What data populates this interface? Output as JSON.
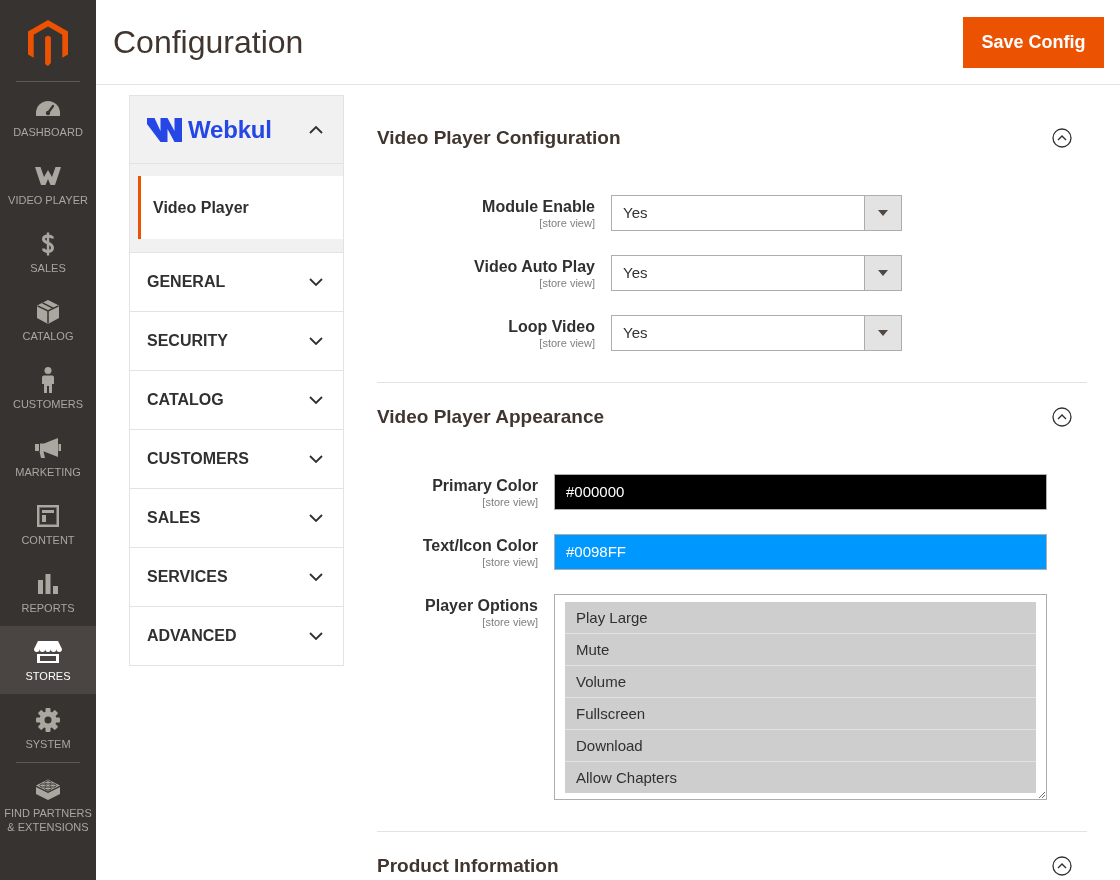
{
  "sidebar": {
    "items": [
      {
        "label": "DASHBOARD",
        "selected": false
      },
      {
        "label": "VIDEO PLAYER",
        "selected": false
      },
      {
        "label": "SALES",
        "selected": false
      },
      {
        "label": "CATALOG",
        "selected": false
      },
      {
        "label": "CUSTOMERS",
        "selected": false
      },
      {
        "label": "MARKETING",
        "selected": false
      },
      {
        "label": "CONTENT",
        "selected": false
      },
      {
        "label": "REPORTS",
        "selected": false
      },
      {
        "label": "STORES",
        "selected": true
      },
      {
        "label": "SYSTEM",
        "selected": false
      },
      {
        "label": "FIND PARTNERS & EXTENSIONS",
        "selected": false
      }
    ]
  },
  "header": {
    "title": "Configuration",
    "save_button": "Save Config"
  },
  "config_tabs": [
    {
      "kind": "logo",
      "title": "Webkul",
      "expanded": true,
      "items": [
        {
          "label": "Video Player",
          "selected": true
        }
      ]
    },
    {
      "kind": "text",
      "title": "GENERAL",
      "expanded": false
    },
    {
      "kind": "text",
      "title": "SECURITY",
      "expanded": false
    },
    {
      "kind": "text",
      "title": "CATALOG",
      "expanded": false
    },
    {
      "kind": "text",
      "title": "CUSTOMERS",
      "expanded": false
    },
    {
      "kind": "text",
      "title": "SALES",
      "expanded": false
    },
    {
      "kind": "text",
      "title": "SERVICES",
      "expanded": false
    },
    {
      "kind": "text",
      "title": "ADVANCED",
      "expanded": false
    }
  ],
  "sections": [
    {
      "title": "Video Player Configuration",
      "expanded": true,
      "fields": [
        {
          "kind": "select",
          "label": "Module Enable",
          "scope": "[store view]",
          "value": "Yes"
        },
        {
          "kind": "select",
          "label": "Video Auto Play",
          "scope": "[store view]",
          "value": "Yes"
        },
        {
          "kind": "select",
          "label": "Loop Video",
          "scope": "[store view]",
          "value": "Yes"
        }
      ]
    },
    {
      "title": "Video Player Appearance",
      "expanded": true,
      "fields": [
        {
          "kind": "color",
          "label": "Primary Color",
          "scope": "[store view]",
          "value": "#000000",
          "color": "#000000"
        },
        {
          "kind": "color",
          "label": "Text/Icon Color",
          "scope": "[store view]",
          "value": "#0098FF",
          "color": "#0098ff"
        },
        {
          "kind": "multiselect",
          "label": "Player Options",
          "scope": "[store view]",
          "options": [
            {
              "label": "Play Large",
              "selected": true
            },
            {
              "label": "Mute",
              "selected": true
            },
            {
              "label": "Volume",
              "selected": true
            },
            {
              "label": "Fullscreen",
              "selected": true
            },
            {
              "label": "Download",
              "selected": true
            },
            {
              "label": "Allow Chapters",
              "selected": true
            }
          ]
        }
      ]
    },
    {
      "title": "Product Information",
      "expanded": true
    }
  ]
}
